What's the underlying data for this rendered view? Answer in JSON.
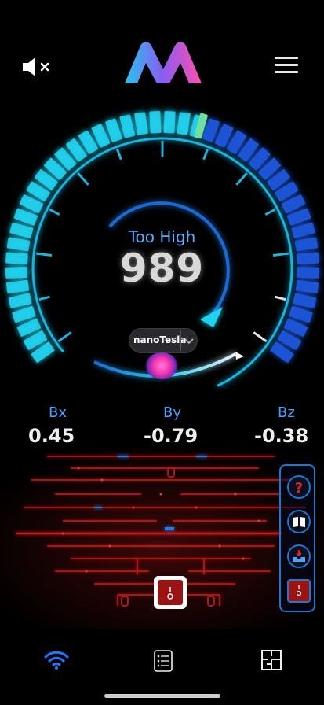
{
  "header": {
    "mute_icon": "speaker-muted-icon",
    "logo_icon": "m-logo-icon",
    "menu_icon": "hamburger-menu-icon"
  },
  "gauge": {
    "status": "Too High",
    "reading": "989",
    "unit": "nanoTesla",
    "unit_dropdown_icon": "chevron-down-icon",
    "level": 0.56,
    "colors": {
      "cyan": "#22d3f0",
      "blue": "#1e55d8",
      "marker": "#6fe0a0",
      "ring": "#19b6e0"
    }
  },
  "axes": [
    {
      "label": "Bx",
      "value": "0.45"
    },
    {
      "label": "By",
      "value": "-0.79"
    },
    {
      "label": "Bz",
      "value": "-0.38"
    }
  ],
  "side_panel": {
    "items": [
      "help-icon",
      "book-icon",
      "inbox-download-icon",
      "power-switch-icon"
    ]
  },
  "bottom_nav": [
    "wifi-icon",
    "list-icon",
    "floor-plan-icon"
  ]
}
